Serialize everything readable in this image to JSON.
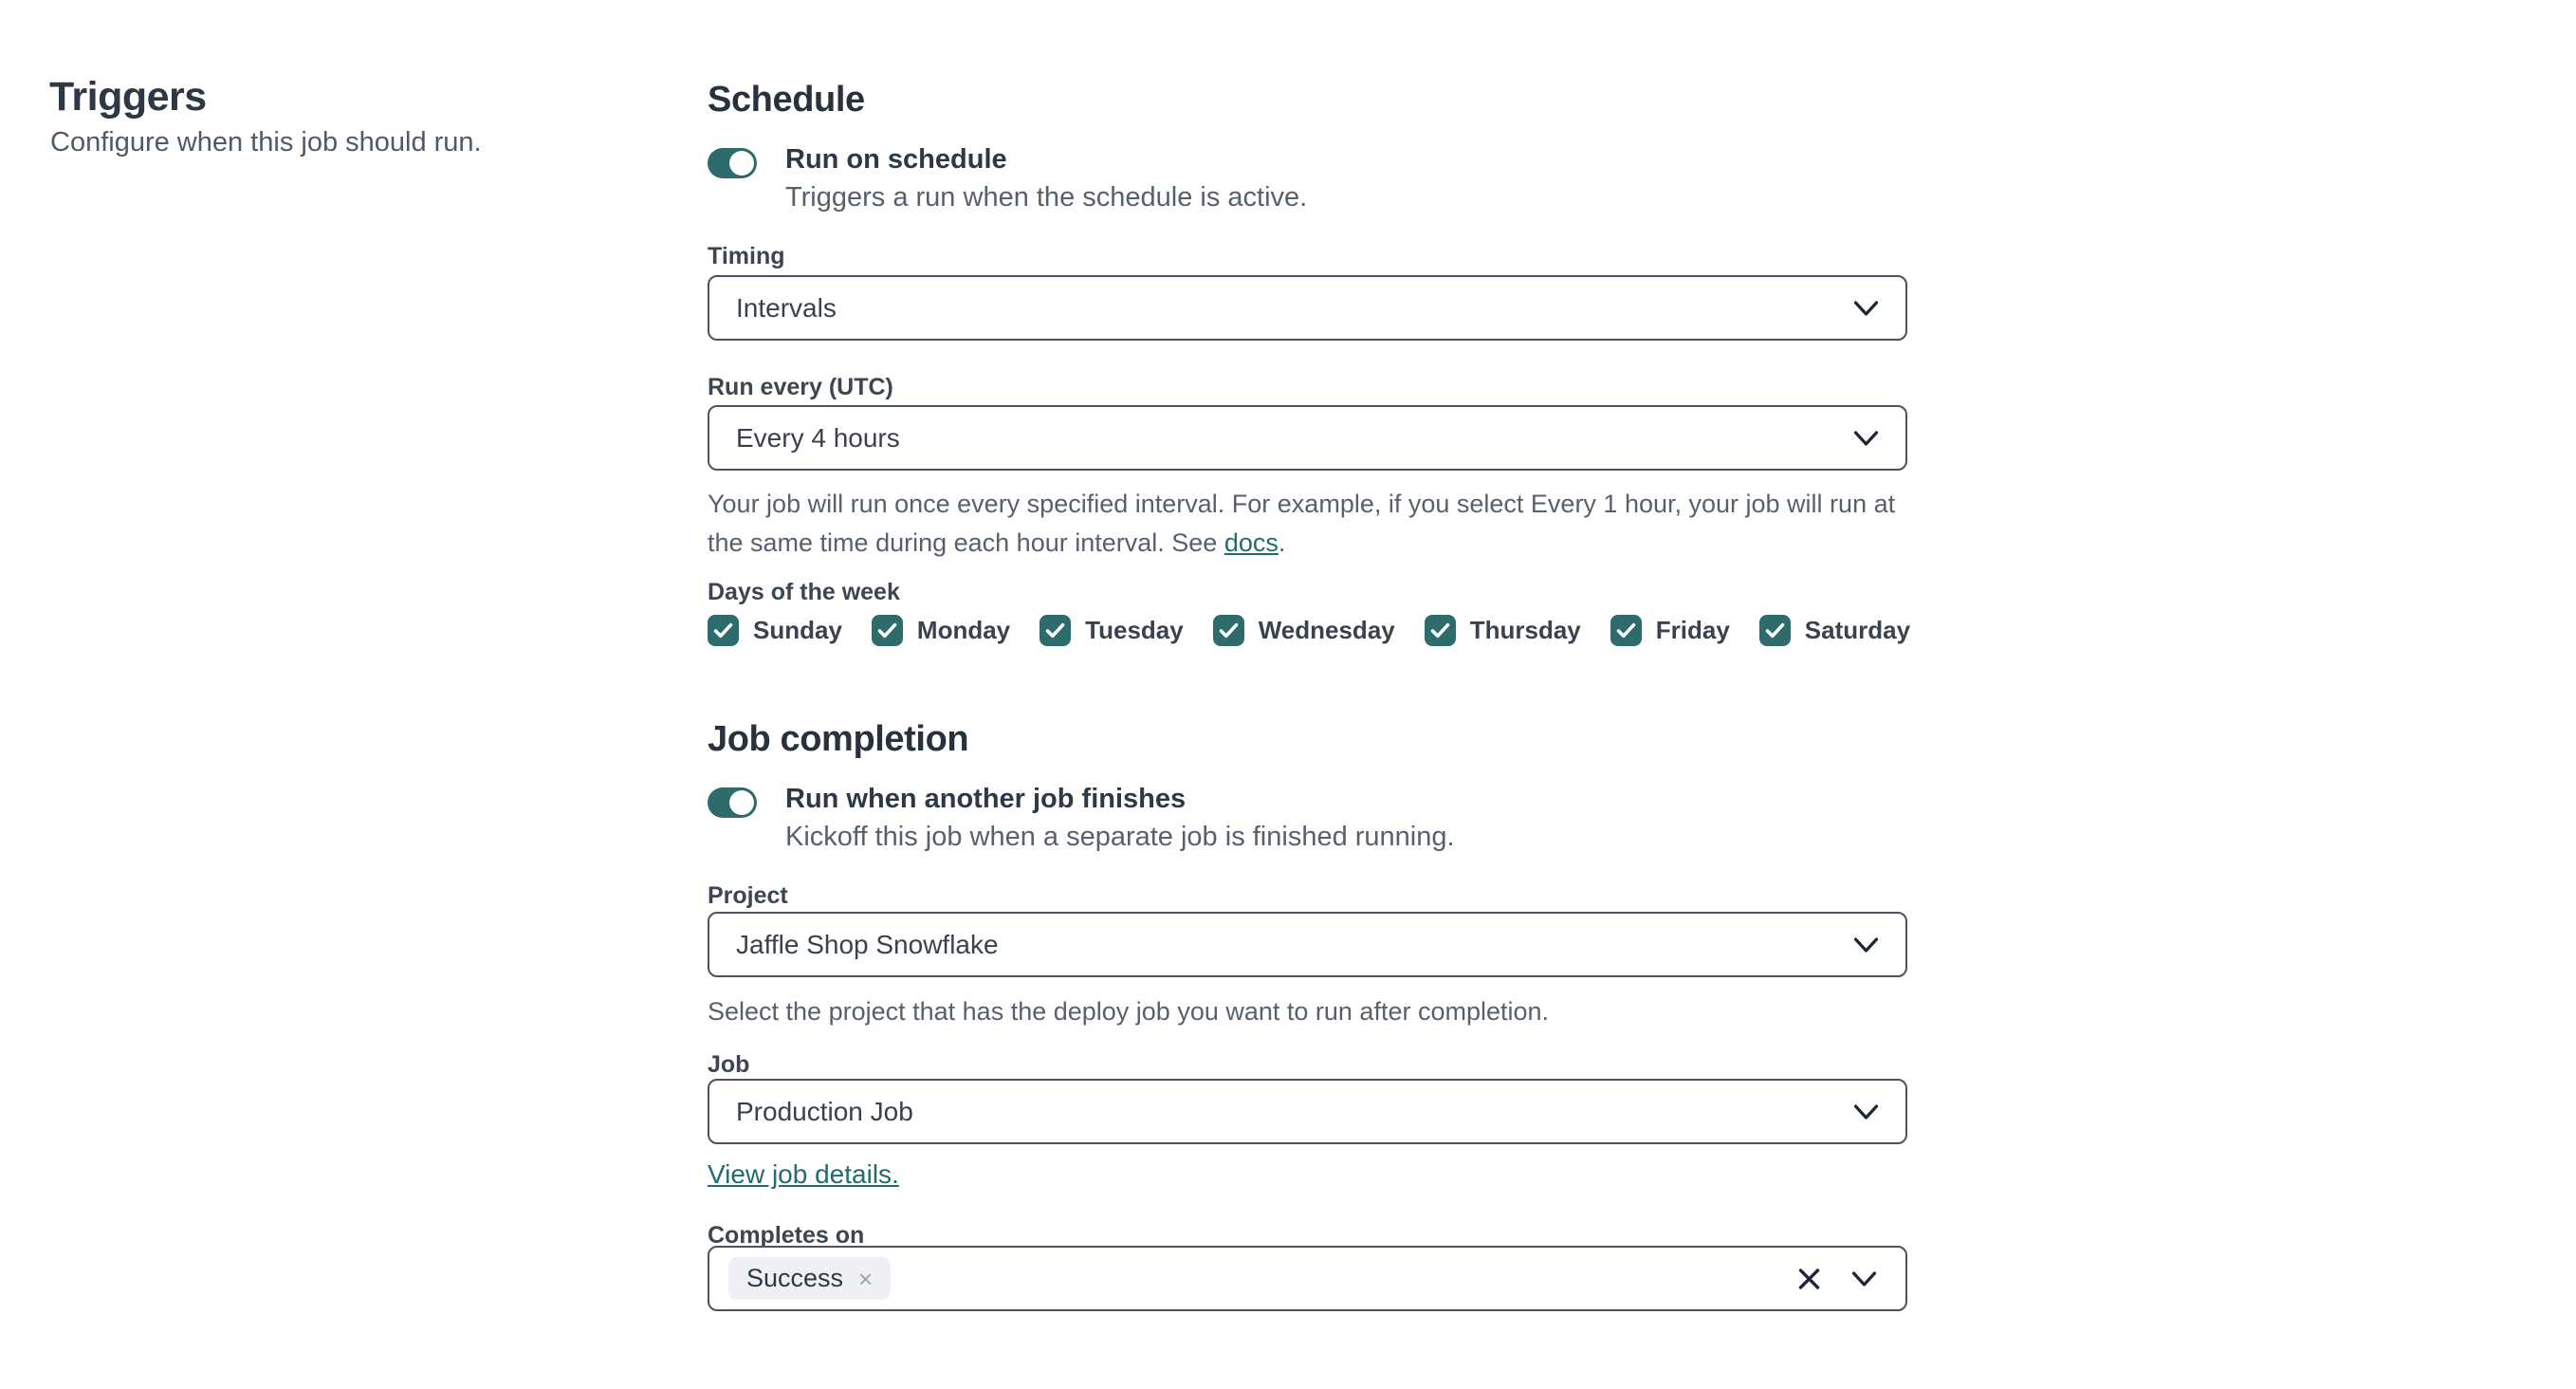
{
  "left": {
    "title": "Triggers",
    "description": "Configure when this job should run."
  },
  "schedule": {
    "heading": "Schedule",
    "run_on_schedule": {
      "label": "Run on schedule",
      "description": "Triggers a run when the schedule is active.",
      "state": "on"
    },
    "timing": {
      "label": "Timing",
      "value": "Intervals"
    },
    "run_every": {
      "label": "Run every (UTC)",
      "value": "Every 4 hours",
      "help_text": "Your job will run once every specified interval. For example, if you select Every 1 hour, your job will run at the same time during each hour interval. See ",
      "help_link": "docs",
      "help_suffix": "."
    },
    "days": {
      "label": "Days of the week",
      "items": [
        {
          "label": "Sunday",
          "checked": true
        },
        {
          "label": "Monday",
          "checked": true
        },
        {
          "label": "Tuesday",
          "checked": true
        },
        {
          "label": "Wednesday",
          "checked": true
        },
        {
          "label": "Thursday",
          "checked": true
        },
        {
          "label": "Friday",
          "checked": true
        },
        {
          "label": "Saturday",
          "checked": true
        }
      ]
    }
  },
  "job_completion": {
    "heading": "Job completion",
    "run_when": {
      "label": "Run when another job finishes",
      "description": "Kickoff this job when a separate job is finished running.",
      "state": "on"
    },
    "project": {
      "label": "Project",
      "value": "Jaffle Shop Snowflake",
      "help": "Select the project that has the deploy job you want to run after completion."
    },
    "job": {
      "label": "Job",
      "value": "Production Job",
      "link": "View job details."
    },
    "completes_on": {
      "label": "Completes on",
      "tags": [
        {
          "label": "Success",
          "remove_icon": "×"
        }
      ]
    }
  },
  "icons": {
    "chevron_down_icon": "v-shape chevron",
    "clear_icon": "×",
    "check_icon": "✓",
    "toggle_knob": "white circle"
  },
  "colors": {
    "accent_teal": "#2e6b6d",
    "link_teal": "#246a6e",
    "heading_text": "#28323f",
    "body_text": "#57616d",
    "field_border": "#4a5360",
    "tag_background": "#eef0f3",
    "icon_dark": "#1c2634"
  }
}
